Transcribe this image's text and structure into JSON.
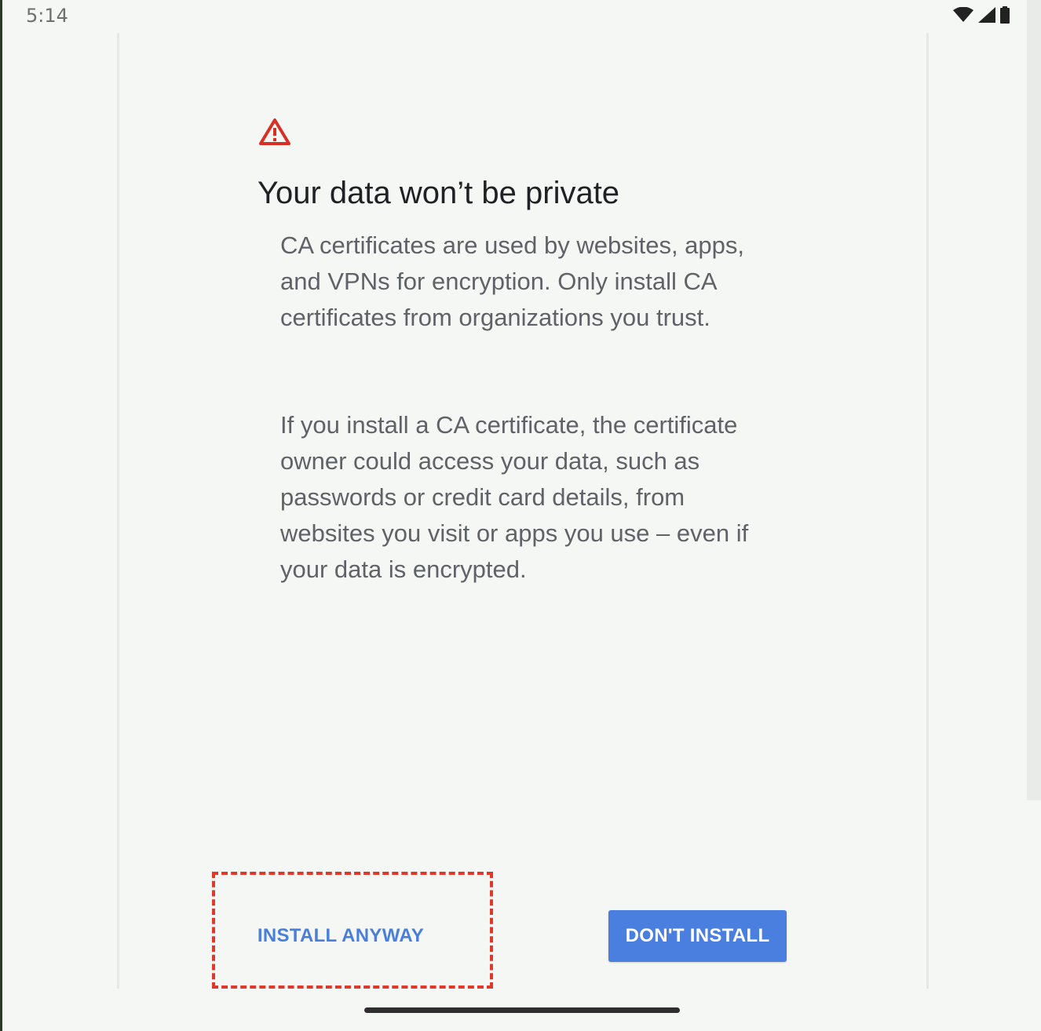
{
  "status_bar": {
    "time": "5:14",
    "icons": [
      "wifi-icon",
      "cellular-signal-icon",
      "battery-icon"
    ]
  },
  "dialog": {
    "icon": "warning-triangle-icon",
    "title": "Your data won’t be private",
    "paragraph_1": "CA certificates are used by websites, apps, and VPNs for encryption. Only install CA certificates from organizations you trust.",
    "paragraph_2": "If you install a CA certificate, the certificate owner could access your data, such as passwords or credit card details, from websites you visit or apps you use – even if your data is encrypted.",
    "install_anyway_label": "INSTALL ANYWAY",
    "dont_install_label": "DON'T INSTALL"
  },
  "colors": {
    "warning": "#d93025",
    "accent": "#4a7fe0",
    "highlight": "#e0392b"
  }
}
